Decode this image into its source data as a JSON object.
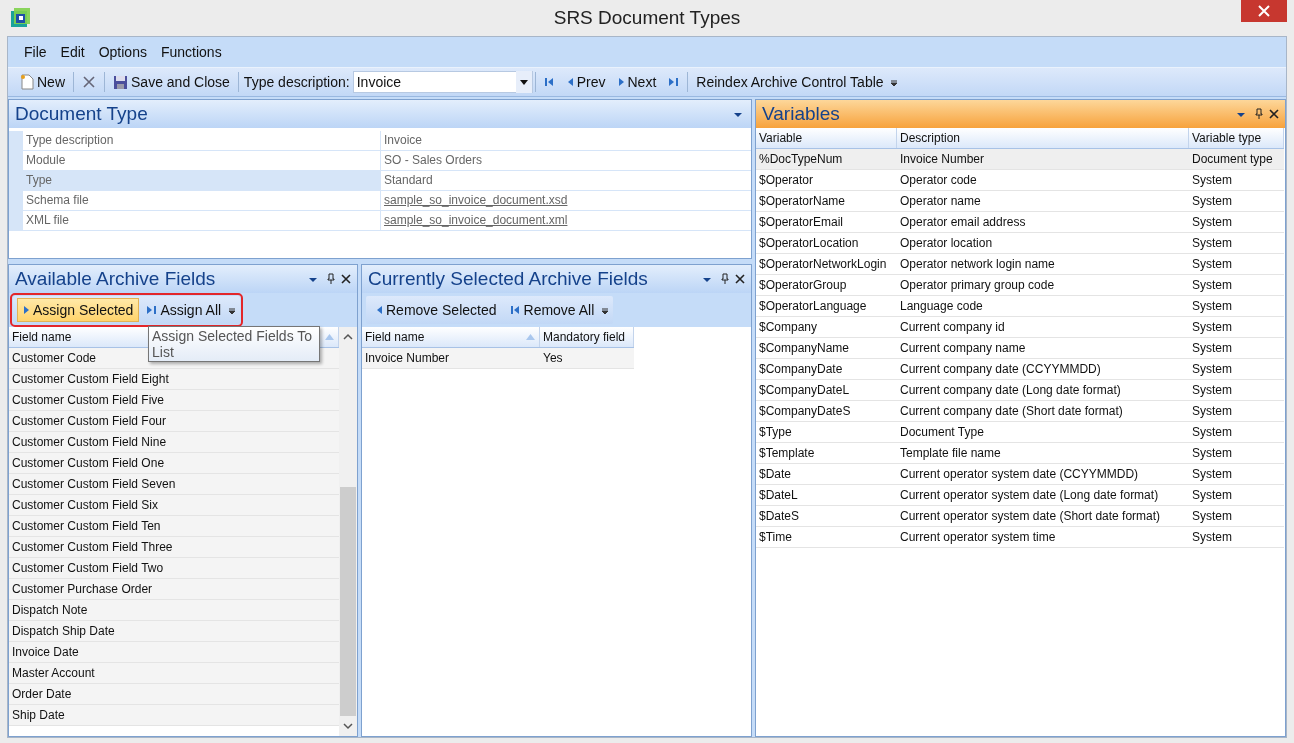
{
  "window": {
    "title": "SRS Document Types"
  },
  "menu": [
    "File",
    "Edit",
    "Options",
    "Functions"
  ],
  "toolbar": {
    "new_label": "New",
    "save_label": "Save and Close",
    "type_label": "Type description:",
    "type_value": "Invoice",
    "prev_label": "Prev",
    "next_label": "Next",
    "reindex_label": "Reindex Archive Control Table"
  },
  "document_type": {
    "title": "Document Type",
    "properties": [
      {
        "label": "Type description",
        "value": "Invoice",
        "kind": "text",
        "selected": false
      },
      {
        "label": "Module",
        "value": "SO - Sales Orders",
        "kind": "text",
        "selected": false
      },
      {
        "label": "Type",
        "value": "Standard",
        "kind": "text",
        "selected": true
      },
      {
        "label": "Schema file",
        "value": "sample_so_invoice_document.xsd",
        "kind": "link",
        "selected": false
      },
      {
        "label": "XML file",
        "value": "sample_so_invoice_document.xml",
        "kind": "link",
        "selected": false
      }
    ]
  },
  "available_fields": {
    "title": "Available Archive Fields",
    "toolbar_highlighted": true,
    "assign_selected": {
      "label": "Assign Selected",
      "hovered": true
    },
    "assign_all": "Assign All",
    "tooltip": "Assign Selected Fields To List",
    "column": "Field name",
    "rows": [
      "Customer Code",
      "Customer Custom Field Eight",
      "Customer Custom Field Five",
      "Customer Custom Field Four",
      "Customer Custom Field Nine",
      "Customer Custom Field One",
      "Customer Custom Field Seven",
      "Customer Custom Field Six",
      "Customer Custom Field Ten",
      "Customer Custom Field Three",
      "Customer Custom Field Two",
      "Customer Purchase Order",
      "Dispatch Note",
      "Dispatch Ship Date",
      "Invoice Date",
      "Master Account",
      "Order Date",
      "Ship Date"
    ]
  },
  "selected_fields": {
    "title": "Currently Selected Archive Fields",
    "remove_selected": "Remove Selected",
    "remove_all": "Remove All",
    "columns": [
      "Field name",
      "Mandatory field"
    ],
    "rows": [
      [
        "Invoice Number",
        "Yes"
      ]
    ]
  },
  "variables": {
    "title": "Variables",
    "columns": [
      "Variable",
      "Description",
      "Variable type"
    ],
    "rows": [
      {
        "cells": [
          "%DocTypeNum",
          "Invoice Number",
          "Document type"
        ],
        "selected": true
      },
      {
        "cells": [
          "$Operator",
          "Operator code",
          "System"
        ],
        "selected": false
      },
      {
        "cells": [
          "$OperatorName",
          "Operator name",
          "System"
        ],
        "selected": false
      },
      {
        "cells": [
          "$OperatorEmail",
          "Operator email address",
          "System"
        ],
        "selected": false
      },
      {
        "cells": [
          "$OperatorLocation",
          "Operator location",
          "System"
        ],
        "selected": false
      },
      {
        "cells": [
          "$OperatorNetworkLogin",
          "Operator network login name",
          "System"
        ],
        "selected": false
      },
      {
        "cells": [
          "$OperatorGroup",
          "Operator primary group code",
          "System"
        ],
        "selected": false
      },
      {
        "cells": [
          "$OperatorLanguage",
          "Language code",
          "System"
        ],
        "selected": false
      },
      {
        "cells": [
          "$Company",
          "Current company id",
          "System"
        ],
        "selected": false
      },
      {
        "cells": [
          "$CompanyName",
          "Current company name",
          "System"
        ],
        "selected": false
      },
      {
        "cells": [
          "$CompanyDate",
          "Current company date (CCYYMMDD)",
          "System"
        ],
        "selected": false
      },
      {
        "cells": [
          "$CompanyDateL",
          "Current company date (Long date format)",
          "System"
        ],
        "selected": false
      },
      {
        "cells": [
          "$CompanyDateS",
          "Current company date (Short date format)",
          "System"
        ],
        "selected": false
      },
      {
        "cells": [
          "$Type",
          "Document Type",
          "System"
        ],
        "selected": false
      },
      {
        "cells": [
          "$Template",
          "Template file name",
          "System"
        ],
        "selected": false
      },
      {
        "cells": [
          "$Date",
          "Current operator system date (CCYYMMDD)",
          "System"
        ],
        "selected": false
      },
      {
        "cells": [
          "$DateL",
          "Current operator system date (Long date format)",
          "System"
        ],
        "selected": false
      },
      {
        "cells": [
          "$DateS",
          "Current operator system date (Short date format)",
          "System"
        ],
        "selected": false
      },
      {
        "cells": [
          "$Time",
          "Current operator system time",
          "System"
        ],
        "selected": false
      }
    ]
  }
}
